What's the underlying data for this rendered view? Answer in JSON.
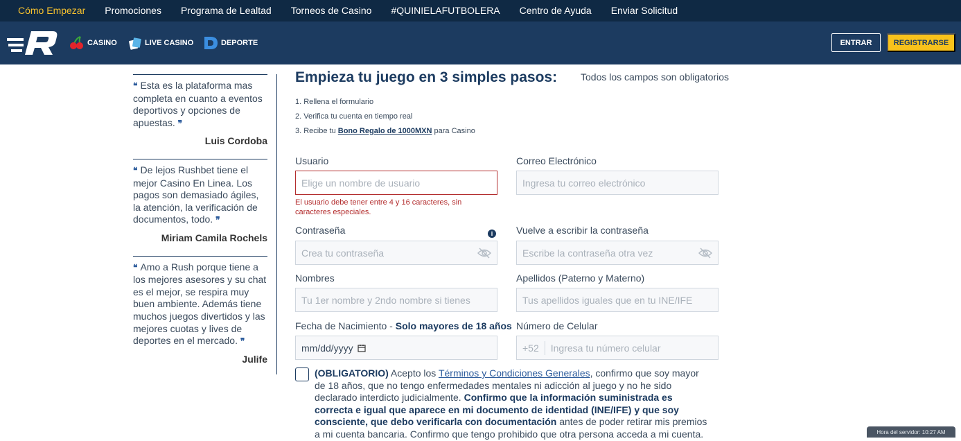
{
  "topnav": {
    "items": [
      {
        "label": "Cómo Empezar"
      },
      {
        "label": "Promociones"
      },
      {
        "label": "Programa de Lealtad"
      },
      {
        "label": "Torneos de Casino"
      },
      {
        "label": "#QUINIELAFUTBOLERA"
      },
      {
        "label": "Centro de Ayuda"
      },
      {
        "label": "Enviar Solicitud"
      }
    ]
  },
  "header": {
    "products": [
      {
        "label": "CASINO",
        "icon": "cherries-icon"
      },
      {
        "label": "LIVE CASINO",
        "icon": "live-casino-icon"
      },
      {
        "label": "DEPORTE",
        "icon": "deporte-icon"
      }
    ],
    "login_label": "ENTRAR",
    "register_label": "REGISTRARSE"
  },
  "testimonials": [
    {
      "text": "Esta es la plataforma mas completa en cuanto a eventos deportivos y opciones de apuestas.",
      "author": "Luis Cordoba"
    },
    {
      "text": "De lejos Rushbet tiene el mejor Casino En Linea. Los pagos son demasiado ágiles, la atención, la verificación de documentos, todo.",
      "author": "Miriam Camila Rochels"
    },
    {
      "text": "Amo a Rush porque tiene a los mejores asesores y su chat es el mejor, se respira muy buen ambiente. Además tiene muchos juegos divertidos y las mejores cuotas y lives de deportes en el mercado.",
      "author": "Julife"
    }
  ],
  "form": {
    "title": "Empieza tu juego en 3 simples pasos:",
    "required_note": "Todos los campos son obligatorios",
    "steps": {
      "s1": "1. Rellena el formulario",
      "s2": "2. Verifica tu cuenta en tiempo real",
      "s3_prefix": "3. Recibe tu ",
      "s3_bonus": "Bono Regalo de 1000MXN",
      "s3_suffix": " para Casino"
    },
    "username": {
      "label": "Usuario",
      "placeholder": "Elige un nombre de usuario",
      "error": "El usuario debe tener entre 4 y 16 caracteres, sin caracteres especiales."
    },
    "email": {
      "label": "Correo Electrónico",
      "placeholder": "Ingresa tu correo electrónico"
    },
    "password": {
      "label": "Contraseña",
      "placeholder": "Crea tu contraseña"
    },
    "password_confirm": {
      "label": "Vuelve a escribir la contraseña",
      "placeholder": "Escribe la contraseña otra vez"
    },
    "names": {
      "label": "Nombres",
      "placeholder": "Tu 1er nombre y 2ndo nombre si tienes"
    },
    "surnames": {
      "label": "Apellidos (Paterno y Materno)",
      "placeholder": "Tus apellidos iguales que en tu INE/IFE"
    },
    "birthdate": {
      "label": "Fecha de Nacimiento - ",
      "label_bold": "Solo mayores de 18 años",
      "value": "mm/dd/yyyy"
    },
    "phone": {
      "label": "Número de Celular",
      "prefix": "+52",
      "placeholder": "Ingresa tu número celular"
    },
    "consent": {
      "bold1": "(OBLIGATORIO)",
      "t1": " Acepto los ",
      "link": "Términos y Condiciones Generales",
      "t2": ", confirmo que soy mayor de 18 años, que no tengo enfermedades mentales ni adicción al juego y no he sido declarado interdicto judicialmente. ",
      "bold2": "Confirmo que la información suministrada es correcta e igual que aparece en mi documento de identidad (INE/IFE) y que soy consciente, que debo verificarla con documentación",
      "t3": " antes de poder retirar mis premios a mi cuenta bancaria. Confirmo que tengo prohibido que otra persona acceda a mi cuenta."
    }
  },
  "server_time": "Hora del servidor: 10:27 AM",
  "colors": {
    "nav": "#0f2944",
    "header": "#1c3b60",
    "accent": "#f8c21b",
    "error": "#b32d2e"
  }
}
